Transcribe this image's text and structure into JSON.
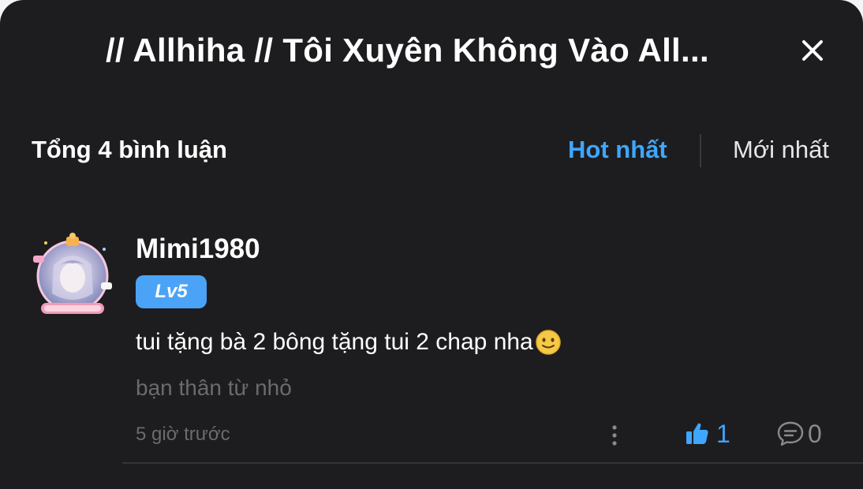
{
  "header": {
    "title": "// Allhiha // Tôi Xuyên Không Vào All...",
    "close_icon": "close-icon"
  },
  "summary": {
    "total_label": "Tổng 4 bình luận",
    "sort_options": [
      {
        "label": "Hot nhất",
        "active": true
      },
      {
        "label": "Mới nhất",
        "active": false
      }
    ]
  },
  "comments": [
    {
      "username": "Mimi1980",
      "level": "Lv5",
      "text": "tui tặng bà 2 bông tặng tui 2 chap nha",
      "emoji": "slightly-smiling-face",
      "signature": "bạn thân từ nhỏ",
      "time": "5 giờ trước",
      "likes": "1",
      "replies": "0",
      "liked": true
    }
  ],
  "colors": {
    "background": "#1d1d1f",
    "accent": "#3ea6ff",
    "level_badge": "#4aa3f6",
    "muted_text": "#6b6b6e"
  }
}
